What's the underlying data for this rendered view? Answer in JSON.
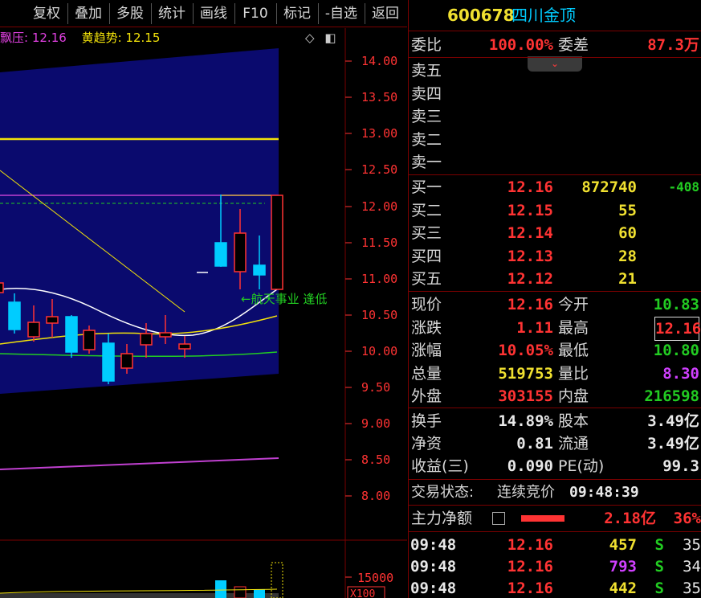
{
  "toolbar": {
    "items": [
      "复权",
      "叠加",
      "多股",
      "统计",
      "画线",
      "F10",
      "标记",
      "-自选",
      "返回"
    ]
  },
  "indicator": {
    "name1": "飘压:",
    "value1": "12.16",
    "name2": "黄趋势:",
    "value2": "12.15",
    "icon1": "diamond-icon",
    "icon2": "panel-toggle-icon"
  },
  "price_axis": [
    "14.00",
    "13.50",
    "13.00",
    "12.50",
    "12.00",
    "11.50",
    "11.00",
    "10.50",
    "10.00",
    "9.50",
    "9.00",
    "8.50",
    "8.00"
  ],
  "volume_axis": {
    "label": "15000",
    "unit": "X100"
  },
  "annotation": "←航天事业 逢低",
  "stock": {
    "code": "600678",
    "name": "四川金顶"
  },
  "weibi": {
    "label1": "委比",
    "value1": "100.00%",
    "label2": "委差",
    "value2": "87.3万"
  },
  "sell_orders": [
    {
      "label": "卖五"
    },
    {
      "label": "卖四"
    },
    {
      "label": "卖三"
    },
    {
      "label": "卖二"
    },
    {
      "label": "卖一"
    }
  ],
  "buy_orders": [
    {
      "label": "买一",
      "price": "12.16",
      "vol": "872740",
      "chg": "-408"
    },
    {
      "label": "买二",
      "price": "12.15",
      "vol": "55",
      "chg": ""
    },
    {
      "label": "买三",
      "price": "12.14",
      "vol": "60",
      "chg": ""
    },
    {
      "label": "买四",
      "price": "12.13",
      "vol": "28",
      "chg": ""
    },
    {
      "label": "买五",
      "price": "12.12",
      "vol": "21",
      "chg": ""
    }
  ],
  "quote": [
    {
      "l1": "现价",
      "v1": "12.16",
      "c1": "red",
      "l2": "今开",
      "v2": "10.83",
      "c2": "green"
    },
    {
      "l1": "涨跌",
      "v1": "1.11",
      "c1": "red",
      "l2": "最高",
      "v2": "12.16",
      "c2": "red"
    },
    {
      "l1": "涨幅",
      "v1": "10.05%",
      "c1": "red",
      "l2": "最低",
      "v2": "10.80",
      "c2": "green"
    },
    {
      "l1": "总量",
      "v1": "519753",
      "c1": "yellow",
      "l2": "量比",
      "v2": "8.30",
      "c2": "magenta"
    },
    {
      "l1": "外盘",
      "v1": "303155",
      "c1": "red",
      "l2": "内盘",
      "v2": "216598",
      "c2": "green"
    }
  ],
  "fundamentals": [
    {
      "l1": "换手",
      "v1": "14.89%",
      "l2": "股本",
      "v2": "3.49亿"
    },
    {
      "l1": "净资",
      "v1": "0.81",
      "l2": "流通",
      "v2": "3.49亿"
    },
    {
      "l1": "收益(三)",
      "v1": "0.090",
      "l2": "PE(动)",
      "v2": "99.3"
    }
  ],
  "status": {
    "label": "交易状态:",
    "value": "连续竞价",
    "time": "09:48:39"
  },
  "main_flow": {
    "label": "主力净额",
    "value": "2.18亿",
    "pct": "36%"
  },
  "ticks": [
    {
      "time": "09:48",
      "price": "12.16",
      "vol": "457",
      "side": "S",
      "n": "35",
      "vc": "yellow"
    },
    {
      "time": "09:48",
      "price": "12.16",
      "vol": "793",
      "side": "S",
      "n": "34",
      "vc": "magenta"
    },
    {
      "time": "09:48",
      "price": "12.16",
      "vol": "442",
      "side": "S",
      "n": "35",
      "vc": "yellow"
    }
  ],
  "colors": {
    "up": "#ff3333",
    "down": "#00ccff",
    "bg": "#000000",
    "grid_red": "#7a0000"
  }
}
